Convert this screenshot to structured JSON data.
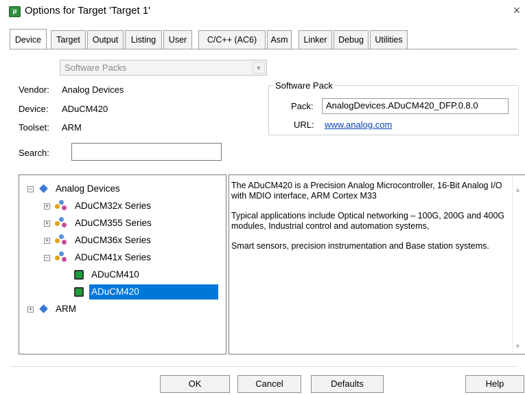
{
  "window": {
    "title": "Options for Target 'Target 1'",
    "close_glyph": "×",
    "app_icon": "µ"
  },
  "tabs": [
    {
      "label": "Device",
      "active": true
    },
    {
      "label": "Target"
    },
    {
      "label": "Output"
    },
    {
      "label": "Listing"
    },
    {
      "label": "User"
    },
    {
      "label": "C/C++ (AC6)"
    },
    {
      "label": "Asm"
    },
    {
      "label": "Linker"
    },
    {
      "label": "Debug"
    },
    {
      "label": "Utilities"
    }
  ],
  "device": {
    "source_select": "Software Packs",
    "vendor_label": "Vendor:",
    "vendor_value": "Analog Devices",
    "device_label": "Device:",
    "device_value": "ADuCM420",
    "toolset_label": "Toolset:",
    "toolset_value": "ARM",
    "search_label": "Search:",
    "search_value": ""
  },
  "software_pack": {
    "group_title": "Software Pack",
    "pack_label": "Pack:",
    "pack_value": "AnalogDevices.ADuCM420_DFP.0.8.0",
    "url_label": "URL:",
    "url_value": "www.analog.com"
  },
  "tree": {
    "root": "Analog Devices",
    "series": [
      "ADuCM32x Series",
      "ADuCM355 Series",
      "ADuCM36x Series",
      "ADuCM41x Series"
    ],
    "devices": [
      "ADuCM410",
      "ADuCM420"
    ],
    "selected": "ADuCM420",
    "other_vendor": "ARM"
  },
  "description": {
    "paragraphs": [
      "The ADuCM420 is a Precision Analog Microcontroller, 16-Bit Analog I/O with MDIO interface, ARM Cortex M33",
      "Typical applications include Optical networking – 100G, 200G and 400G modules, Industrial control and automation systems,",
      "Smart sensors, precision instrumentation and Base station systems."
    ]
  },
  "buttons": {
    "ok": "OK",
    "cancel": "Cancel",
    "defaults": "Defaults",
    "help": "Help"
  },
  "colors": {
    "selection": "#0078d7",
    "link": "#0645ad",
    "chip_icon": "#1e9c3a",
    "diamond_icon": "#3a78d6"
  }
}
